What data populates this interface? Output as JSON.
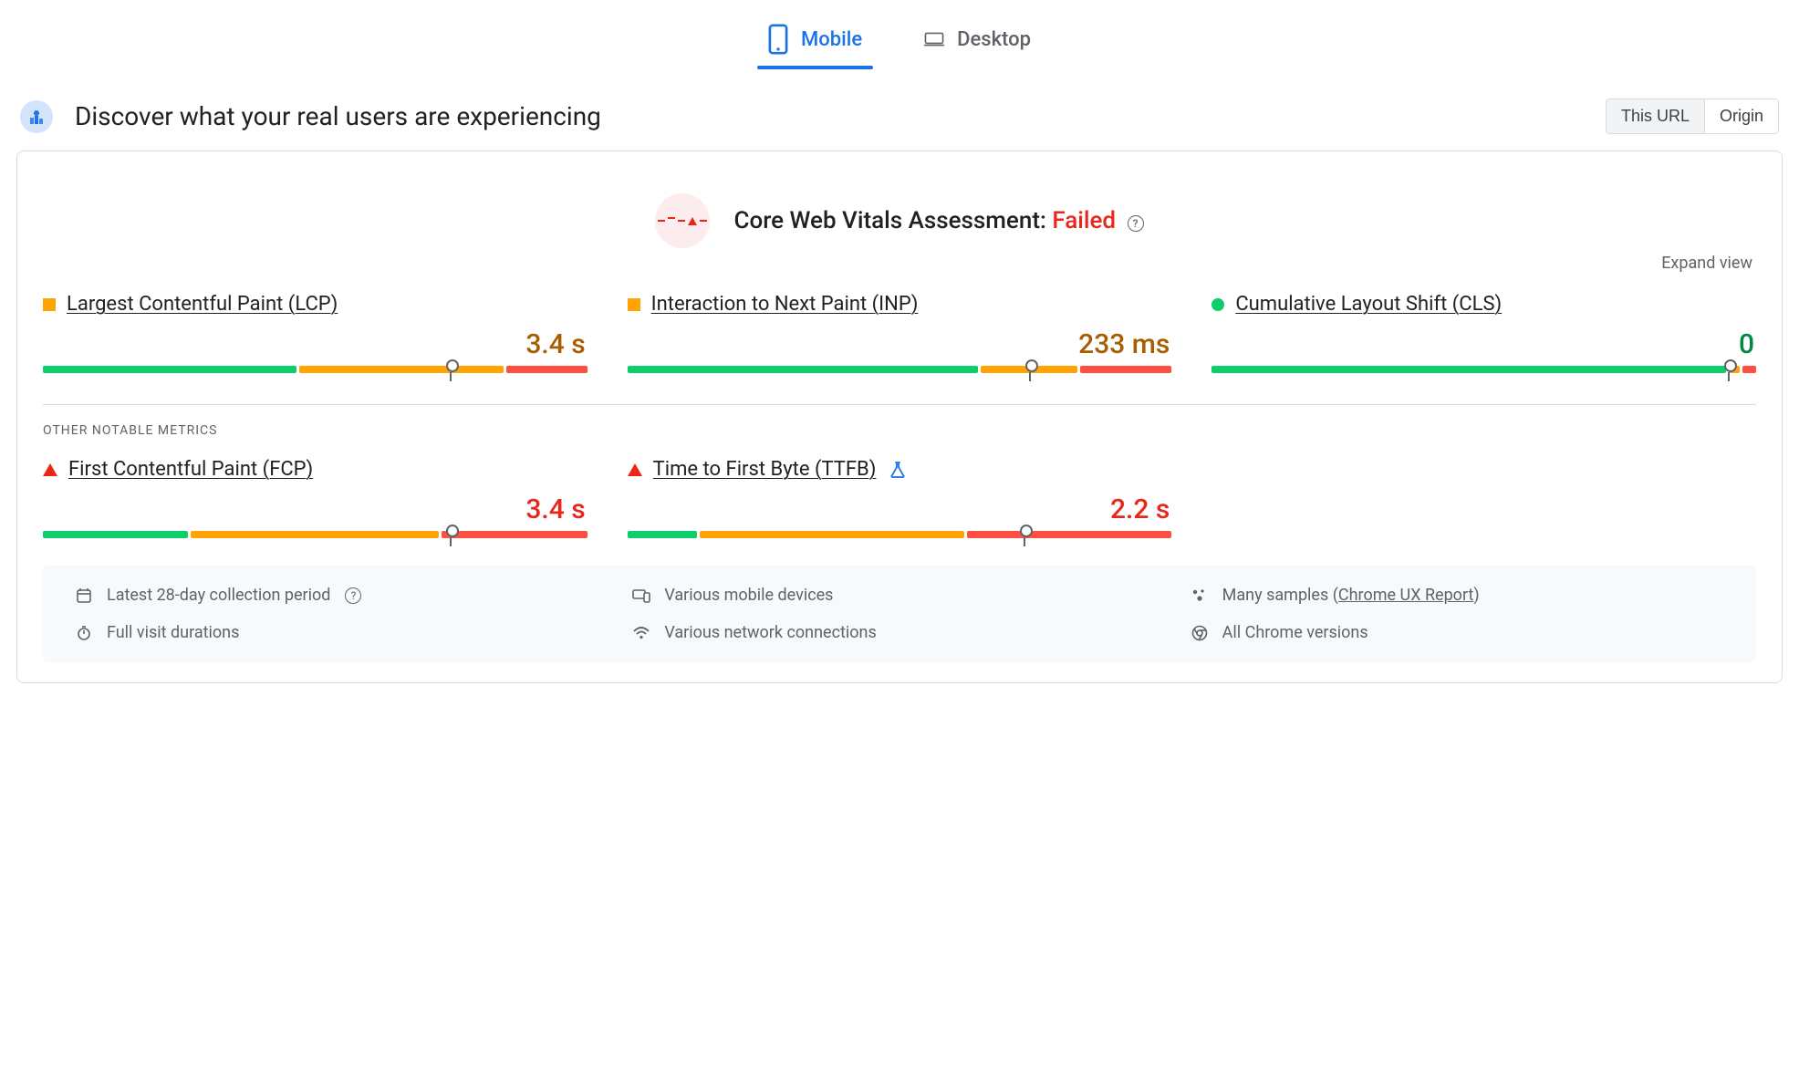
{
  "tabs": {
    "mobile": "Mobile",
    "desktop": "Desktop"
  },
  "header": {
    "title": "Discover what your real users are experiencing",
    "seg_this_url": "This URL",
    "seg_origin": "Origin"
  },
  "assessment": {
    "label": "Core Web Vitals Assessment: ",
    "status": "Failed"
  },
  "expand_label": "Expand view",
  "section_other": "OTHER NOTABLE METRICS",
  "metrics": {
    "lcp": {
      "name": "Largest Contentful Paint (LCP)",
      "value": "3.4 s",
      "status": "warn",
      "bar_pct": [
        47,
        38,
        15
      ],
      "marker_pct": 75
    },
    "inp": {
      "name": "Interaction to Next Paint (INP)",
      "value": "233 ms",
      "status": "warn",
      "bar_pct": [
        65,
        18,
        17
      ],
      "marker_pct": 74
    },
    "cls": {
      "name": "Cumulative Layout Shift (CLS)",
      "value": "0",
      "status": "good",
      "bar_pct": [
        95.5,
        2,
        2.5
      ],
      "marker_pct": 95
    },
    "fcp": {
      "name": "First Contentful Paint (FCP)",
      "value": "3.4 s",
      "status": "poor",
      "bar_pct": [
        27,
        46,
        27
      ],
      "marker_pct": 75
    },
    "ttfb": {
      "name": "Time to First Byte (TTFB)",
      "value": "2.2 s",
      "status": "poor",
      "bar_pct": [
        13,
        49,
        38
      ],
      "marker_pct": 73
    }
  },
  "info": {
    "period": "Latest 28-day collection period",
    "devices": "Various mobile devices",
    "samples_pre": "Many samples (",
    "samples_link": "Chrome UX Report",
    "samples_post": ")",
    "durations": "Full visit durations",
    "network": "Various network connections",
    "versions": "All Chrome versions"
  }
}
